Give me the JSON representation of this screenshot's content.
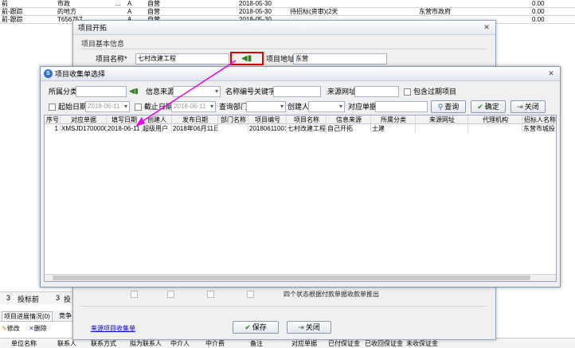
{
  "background_rows": [
    [
      "前",
      "市政",
      "...",
      "A",
      "自营",
      "",
      "2018-05-30",
      "",
      "",
      "",
      "0.00"
    ],
    [
      "前-跟踪",
      "的地方",
      "",
      "A",
      "自营",
      "",
      "2018-05-30",
      "待招标(资审)(2天",
      "",
      "东营市政府",
      "0.00"
    ],
    [
      "前-跟踪",
      "T656757",
      "",
      "A",
      "自营",
      "",
      "2018-05-30",
      "",
      "",
      "",
      "0.00"
    ]
  ],
  "outer_dialog": {
    "title": "项目开拓",
    "section_title": "项目基本信息",
    "project_name_label": "项目名称*",
    "project_name_value": "七村改建工程",
    "project_address_label": "项目地址",
    "project_address_value": "东营",
    "link_text": "来源项目收集单",
    "save_label": "保存",
    "close_label": "关闭"
  },
  "inner_dialog": {
    "title": "项目收集单选择",
    "filters": {
      "category_label": "所属分类",
      "info_source_label": "信息来源",
      "name_keyword_label": "名称编号关键字",
      "source_url_label": "来源网址",
      "include_expired_label": "包含过期项目",
      "start_date_label": "起始日期",
      "start_date_value": "2018-06-11",
      "end_date_label": "截止日期",
      "end_date_value": "2018-06-11",
      "query_dept_label": "查询部门",
      "creator_label": "创建人",
      "matched_form_label": "对应单据"
    },
    "query_label": "查询",
    "confirm_label": "确定",
    "close_label": "关闭",
    "columns": [
      "序号",
      "对应单据",
      "填写日期",
      "创建人",
      "发布日期",
      "部门名称",
      "项目编号",
      "项目名称",
      "信息来源",
      "所属分类",
      "来源网址",
      "代理机构",
      "招标人名称"
    ],
    "rows": [
      [
        "1",
        "XMSJD170000001",
        "2018-06-11",
        "超级用户",
        "2018年06月11日",
        "",
        "20180611001",
        "七村改建工程",
        "自己开拓",
        "土建",
        "",
        "",
        "东营市城投"
      ]
    ]
  },
  "bottom_panel": {
    "counter_1": "3",
    "counter_1_label": "投标前",
    "counter_2": "3",
    "counter_2_label": "投",
    "tab_label": "项目进展情况(0)",
    "tab_label_2": "竞争",
    "edit_label": "修改",
    "delete_label": "删除",
    "faded_text": "四个状态根据付款单据收款单推出",
    "columns": [
      "单位名称",
      "联系人",
      "联系方式",
      "拟为联系人",
      "中介人",
      "中介费",
      "备注",
      "对应单据",
      "已付保证金",
      "已收回保证金",
      "未收保证金"
    ]
  },
  "colors": {
    "titlebar": "#dfe5ee",
    "highlight_box": "#e00000",
    "arrow": "#ee00ee",
    "link": "#0000cc"
  }
}
